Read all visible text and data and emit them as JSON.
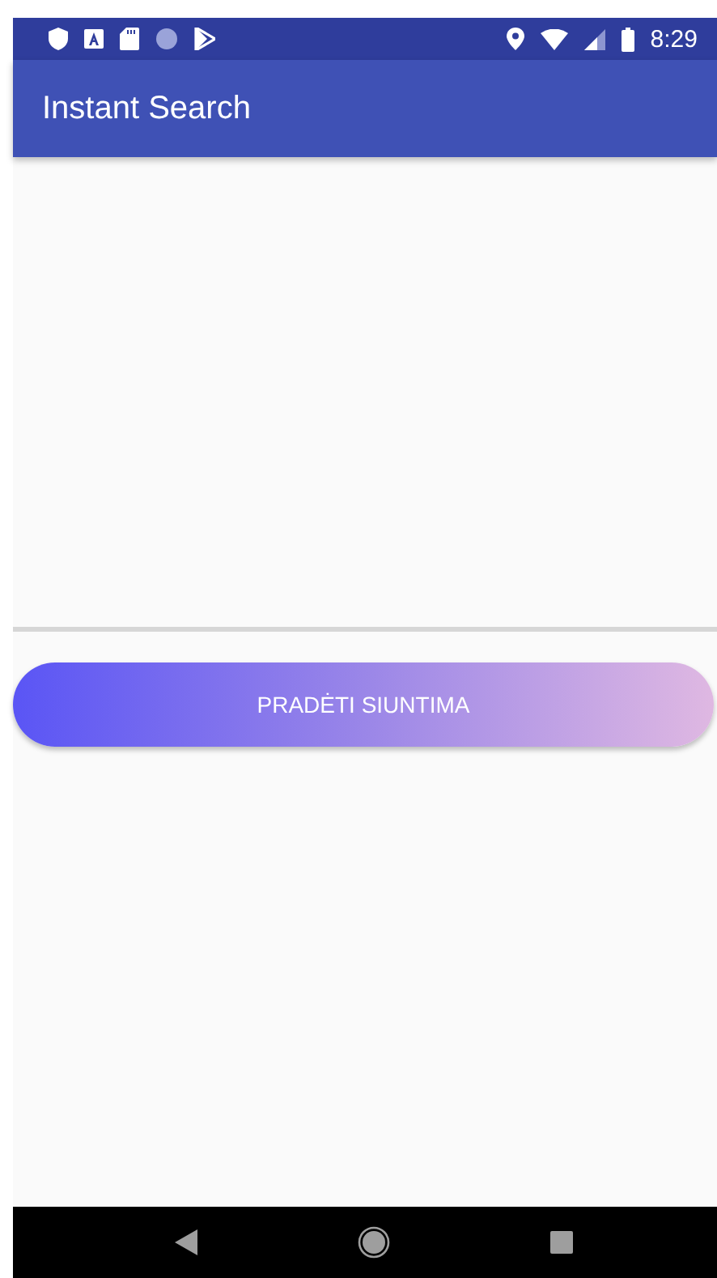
{
  "status_bar": {
    "time": "8:29"
  },
  "app_bar": {
    "title": "Instant Search"
  },
  "button": {
    "label": "PRADĖTI SIUNTIMA"
  }
}
